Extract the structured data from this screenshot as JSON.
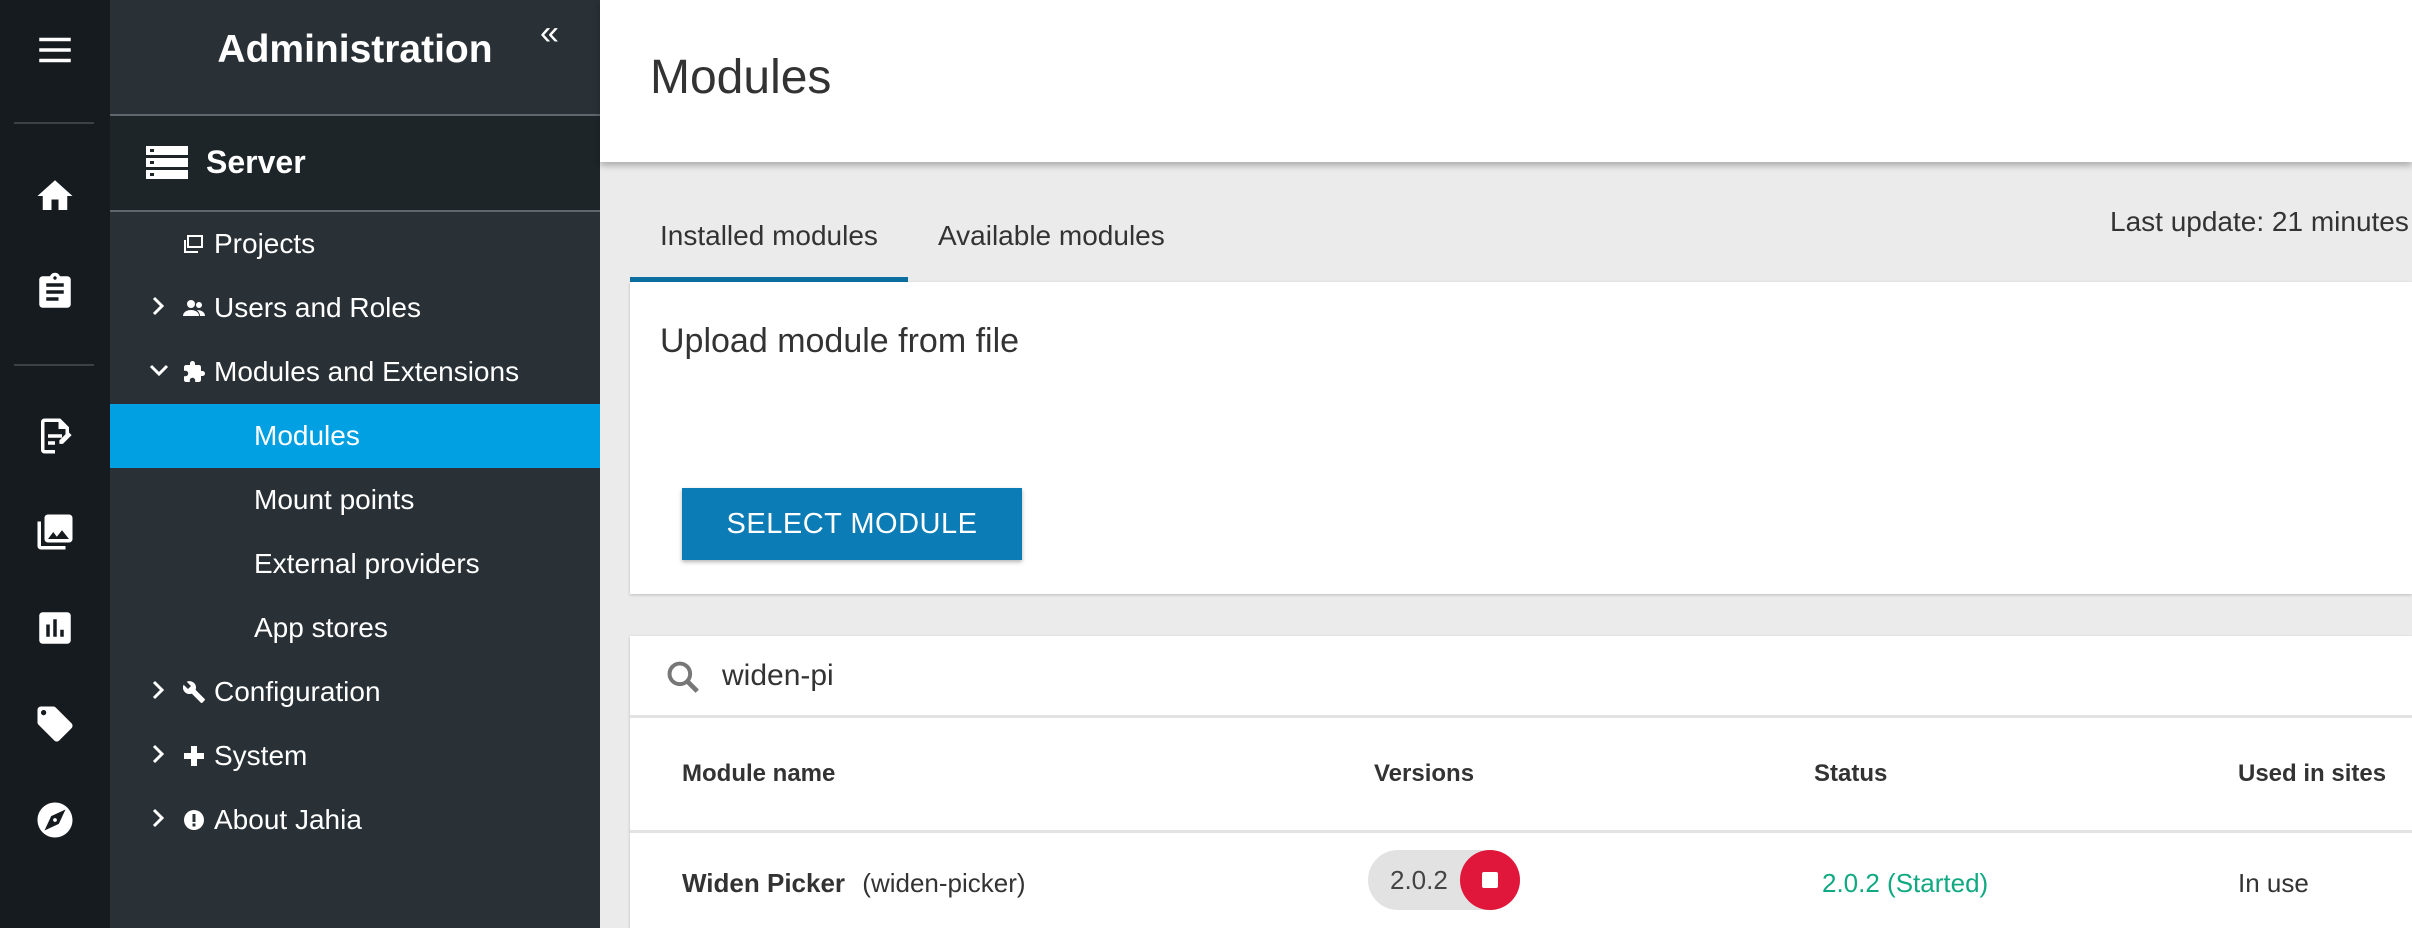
{
  "sidebar": {
    "title": "Administration",
    "collapse_glyph": "«",
    "server_label": "Server",
    "items": [
      {
        "label": "Projects"
      },
      {
        "label": "Users and Roles"
      },
      {
        "label": "Modules and Extensions"
      },
      {
        "label": "Modules"
      },
      {
        "label": "Mount points"
      },
      {
        "label": "External providers"
      },
      {
        "label": "App stores"
      },
      {
        "label": "Configuration"
      },
      {
        "label": "System"
      },
      {
        "label": "About Jahia"
      }
    ]
  },
  "rail": {
    "icons": [
      "menu-icon",
      "home-icon",
      "clipboard-icon",
      "document-edit-icon",
      "image-gallery-icon",
      "bar-chart-icon",
      "tag-icon",
      "compass-icon"
    ]
  },
  "page": {
    "title": "Modules"
  },
  "tabs": [
    {
      "label": "Installed modules",
      "active": true
    },
    {
      "label": "Available modules",
      "active": false
    }
  ],
  "last_update": "Last update: 21 minutes",
  "upload": {
    "title": "Upload module from file",
    "button_label": "SELECT MODULE"
  },
  "search": {
    "value": "widen-pi"
  },
  "table": {
    "columns": [
      "Module name",
      "Versions",
      "Status",
      "Used in sites"
    ],
    "rows": [
      {
        "name": "Widen Picker",
        "id": "(widen-picker)",
        "version": "2.0.2",
        "status": "2.0.2 (Started)",
        "used": "In use"
      }
    ]
  },
  "colors": {
    "active_nav": "#00a0e3",
    "primary_button": "#0b7cb6",
    "stop_button": "#e0163a",
    "status_started": "#10a982"
  }
}
